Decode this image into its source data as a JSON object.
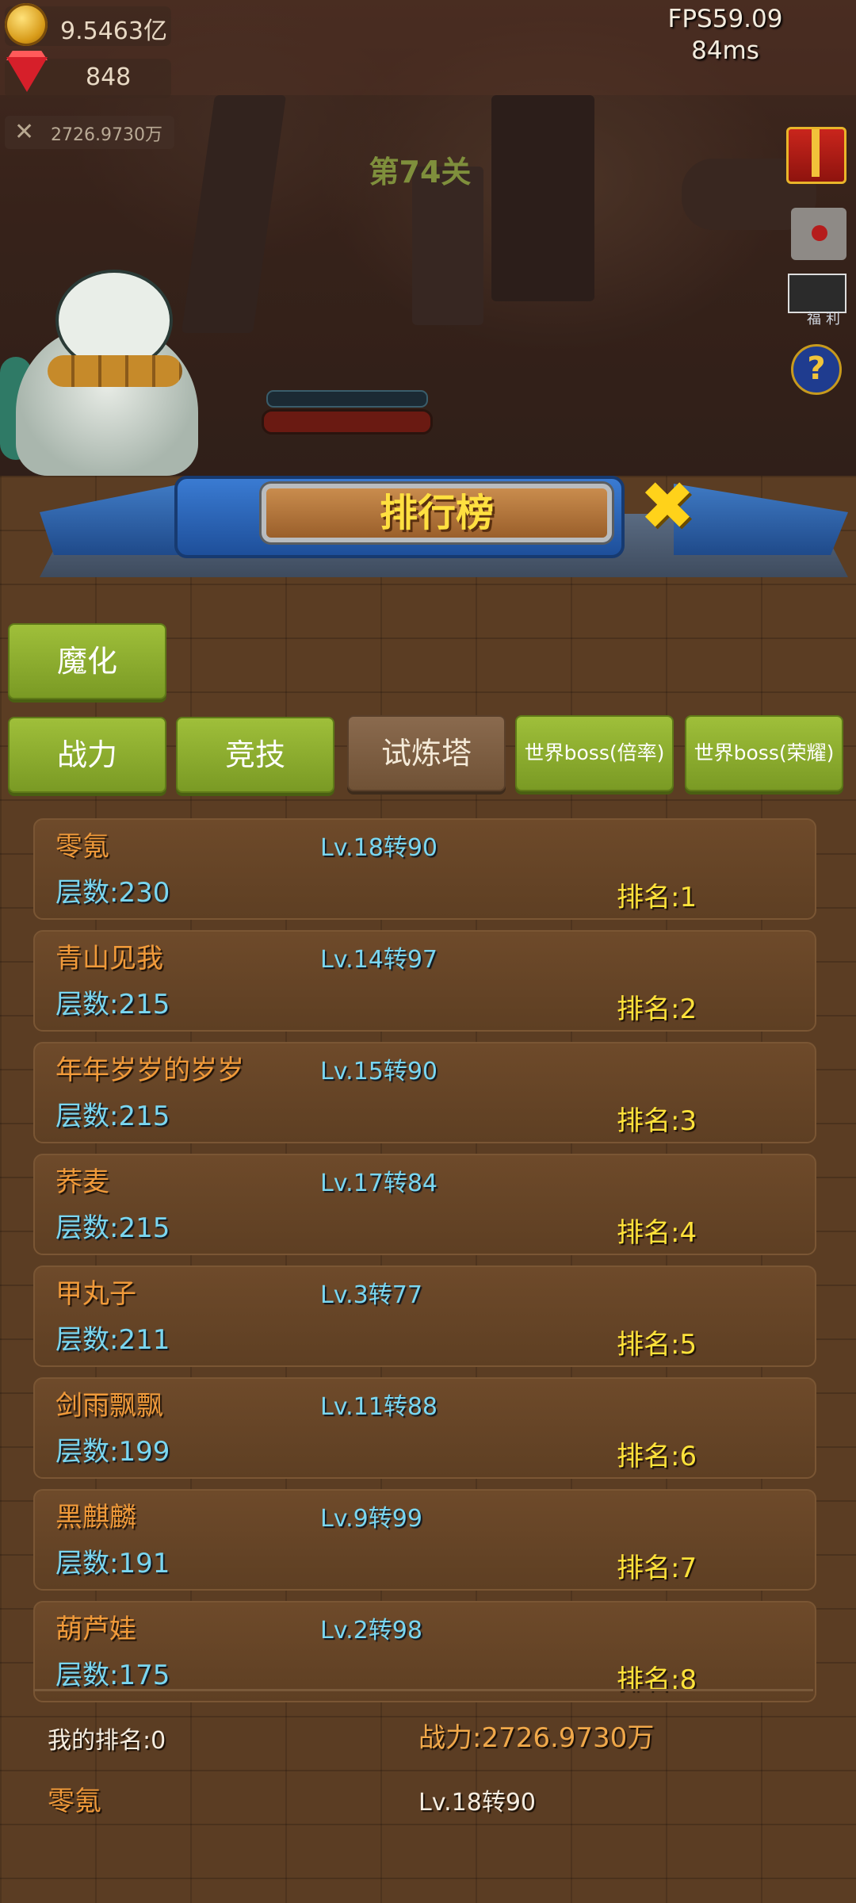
{
  "hud": {
    "gold": "9.5463亿",
    "gems": "848",
    "power": "2726.9730万",
    "fps": "FPS59.09",
    "latency": "84ms",
    "stage": "第74关",
    "welfare_label": "福利"
  },
  "panel": {
    "title": "排行榜",
    "tabs_row1": [
      "魔化"
    ],
    "tabs_row2": [
      "战力",
      "竞技",
      "试炼塔",
      "世界boss(倍率)",
      "世界boss(荣耀)"
    ],
    "active_tab": "试炼塔"
  },
  "rankings": [
    {
      "name": "零氪",
      "level": "Lv.18转90",
      "floor": "层数:230",
      "rank": "排名:1"
    },
    {
      "name": "青山见我",
      "level": "Lv.14转97",
      "floor": "层数:215",
      "rank": "排名:2"
    },
    {
      "name": "年年岁岁的岁岁",
      "level": "Lv.15转90",
      "floor": "层数:215",
      "rank": "排名:3"
    },
    {
      "name": "荞麦",
      "level": "Lv.17转84",
      "floor": "层数:215",
      "rank": "排名:4"
    },
    {
      "name": "甲丸子",
      "level": "Lv.3转77",
      "floor": "层数:211",
      "rank": "排名:5"
    },
    {
      "name": "剑雨飘飘",
      "level": "Lv.11转88",
      "floor": "层数:199",
      "rank": "排名:6"
    },
    {
      "name": "黑麒麟",
      "level": "Lv.9转99",
      "floor": "层数:191",
      "rank": "排名:7"
    },
    {
      "name": "葫芦娃",
      "level": "Lv.2转98",
      "floor": "层数:175",
      "rank": "排名:8"
    }
  ],
  "me": {
    "my_rank": "我的排名:0",
    "power": "战力:2726.9730万",
    "name": "零氪",
    "level": "Lv.18转90"
  }
}
